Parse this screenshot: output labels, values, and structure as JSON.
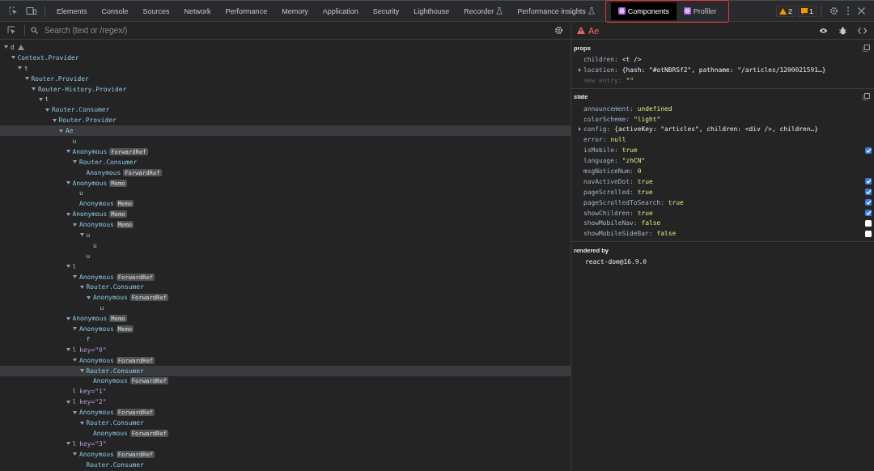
{
  "toolbar": {
    "tabs": [
      {
        "label": "Elements",
        "kind": "plain",
        "selected": false,
        "highlighted": false
      },
      {
        "label": "Console",
        "kind": "plain",
        "selected": false,
        "highlighted": false
      },
      {
        "label": "Sources",
        "kind": "plain",
        "selected": false,
        "highlighted": false
      },
      {
        "label": "Network",
        "kind": "plain",
        "selected": false,
        "highlighted": false
      },
      {
        "label": "Performance",
        "kind": "plain",
        "selected": false,
        "highlighted": false
      },
      {
        "label": "Memory",
        "kind": "plain",
        "selected": false,
        "highlighted": false
      },
      {
        "label": "Application",
        "kind": "plain",
        "selected": false,
        "highlighted": false
      },
      {
        "label": "Security",
        "kind": "plain",
        "selected": false,
        "highlighted": false
      },
      {
        "label": "Lighthouse",
        "kind": "plain",
        "selected": false,
        "highlighted": false
      },
      {
        "label": "Recorder",
        "kind": "experimental",
        "selected": false,
        "highlighted": false
      },
      {
        "label": "Performance insights",
        "kind": "experimental",
        "selected": false,
        "highlighted": false
      },
      {
        "label": "Components",
        "kind": "react",
        "selected": true,
        "highlighted": true
      },
      {
        "label": "Profiler",
        "kind": "react",
        "selected": false,
        "highlighted": true
      }
    ],
    "issues": [
      {
        "kind": "warning",
        "count": "2"
      },
      {
        "kind": "info",
        "count": "1"
      }
    ]
  },
  "tree": {
    "search": {
      "placeholder": "Search (text or /regex/)"
    },
    "nodes": [
      {
        "name": "d",
        "warning": true,
        "selected": false,
        "children": [
          {
            "name": "Context.Provider",
            "selected": false,
            "children": [
              {
                "name": "t",
                "selected": false,
                "children": [
                  {
                    "name": "Router.Provider",
                    "selected": false,
                    "children": [
                      {
                        "name": "Router-History.Provider",
                        "selected": false,
                        "children": [
                          {
                            "name": "t",
                            "selected": false,
                            "children": [
                              {
                                "name": "Router.Consumer",
                                "selected": false,
                                "children": [
                                  {
                                    "name": "Router.Provider",
                                    "selected": false,
                                    "children": [
                                      {
                                        "name": "Ae",
                                        "selected": true,
                                        "children": [
                                          {
                                            "name": "u",
                                            "selected": false
                                          },
                                          {
                                            "name": "Anonymous",
                                            "badge": "ForwardRef",
                                            "selected": false,
                                            "children": [
                                              {
                                                "name": "Router.Consumer",
                                                "selected": false,
                                                "children": [
                                                  {
                                                    "name": "Anonymous",
                                                    "badge": "ForwardRef",
                                                    "selected": false
                                                  }
                                                ]
                                              }
                                            ]
                                          },
                                          {
                                            "name": "Anonymous",
                                            "badge": "Memo",
                                            "selected": false,
                                            "children": [
                                              {
                                                "name": "u",
                                                "selected": false
                                              },
                                              {
                                                "name": "Anonymous",
                                                "badge": "Memo",
                                                "selected": false
                                              }
                                            ]
                                          },
                                          {
                                            "name": "Anonymous",
                                            "badge": "Memo",
                                            "selected": false,
                                            "children": [
                                              {
                                                "name": "Anonymous",
                                                "badge": "Memo",
                                                "selected": false,
                                                "children": [
                                                  {
                                                    "name": "u",
                                                    "selected": false,
                                                    "children": [
                                                      {
                                                        "name": "u",
                                                        "selected": false
                                                      }
                                                    ]
                                                  },
                                                  {
                                                    "name": "u",
                                                    "selected": false
                                                  }
                                                ]
                                              }
                                            ]
                                          },
                                          {
                                            "name": "l",
                                            "selected": false,
                                            "children": [
                                              {
                                                "name": "Anonymous",
                                                "badge": "ForwardRef",
                                                "selected": false,
                                                "children": [
                                                  {
                                                    "name": "Router.Consumer",
                                                    "selected": false,
                                                    "children": [
                                                      {
                                                        "name": "Anonymous",
                                                        "badge": "ForwardRef",
                                                        "selected": false,
                                                        "children": [
                                                          {
                                                            "name": "u",
                                                            "selected": false
                                                          }
                                                        ]
                                                      }
                                                    ]
                                                  }
                                                ]
                                              }
                                            ]
                                          },
                                          {
                                            "name": "Anonymous",
                                            "badge": "Memo",
                                            "selected": false,
                                            "children": [
                                              {
                                                "name": "Anonymous",
                                                "badge": "Memo",
                                                "selected": false,
                                                "children": [
                                                  {
                                                    "name": "f",
                                                    "selected": false
                                                  }
                                                ]
                                              }
                                            ]
                                          },
                                          {
                                            "name": "l",
                                            "key": "key=\"0\"",
                                            "selected": false,
                                            "children": [
                                              {
                                                "name": "Anonymous",
                                                "badge": "ForwardRef",
                                                "selected": false,
                                                "children": [
                                                  {
                                                    "name": "Router.Consumer",
                                                    "selected": true,
                                                    "children": [
                                                      {
                                                        "name": "Anonymous",
                                                        "badge": "ForwardRef",
                                                        "selected": false
                                                      }
                                                    ]
                                                  }
                                                ]
                                              }
                                            ]
                                          },
                                          {
                                            "name": "l",
                                            "key": "key=\"1\"",
                                            "selected": false
                                          },
                                          {
                                            "name": "l",
                                            "key": "key=\"2\"",
                                            "selected": false,
                                            "children": [
                                              {
                                                "name": "Anonymous",
                                                "badge": "ForwardRef",
                                                "selected": false,
                                                "children": [
                                                  {
                                                    "name": "Router.Consumer",
                                                    "selected": false,
                                                    "children": [
                                                      {
                                                        "name": "Anonymous",
                                                        "badge": "ForwardRef",
                                                        "selected": false
                                                      }
                                                    ]
                                                  }
                                                ]
                                              }
                                            ]
                                          },
                                          {
                                            "name": "l",
                                            "key": "key=\"3\"",
                                            "selected": false,
                                            "children": [
                                              {
                                                "name": "Anonymous",
                                                "badge": "ForwardRef",
                                                "selected": false,
                                                "children": [
                                                  {
                                                    "name": "Router.Consumer",
                                                    "selected": false
                                                  }
                                                ]
                                              }
                                            ]
                                          }
                                        ]
                                      }
                                    ]
                                  }
                                ]
                              }
                            ]
                          }
                        ]
                      }
                    ]
                  }
                ]
              }
            ]
          }
        ]
      }
    ]
  },
  "inspector": {
    "component": "Ae",
    "warning": true,
    "sections": [
      {
        "title": "props",
        "items": [
          {
            "kind": "element",
            "name": "children:",
            "value": "<t />"
          },
          {
            "kind": "object",
            "name": "location:",
            "value": "{hash: \"#otNBRSf2\", pathname: \"/articles/1200021591…}"
          },
          {
            "kind": "new-entry",
            "name": "new entry:",
            "value": "\"\""
          }
        ]
      },
      {
        "title": "state",
        "items": [
          {
            "kind": "literal",
            "name": "announcement:",
            "value": "undefined"
          },
          {
            "kind": "literal",
            "name": "colorScheme:",
            "value": "\"light\""
          },
          {
            "kind": "object",
            "name": "config:",
            "value": "{activeKey: \"articles\", children: <div />, children…}"
          },
          {
            "kind": "literal",
            "name": "error:",
            "value": "null"
          },
          {
            "kind": "boolean",
            "name": "isMobile:",
            "value": "true",
            "checked": true
          },
          {
            "kind": "literal",
            "name": "language:",
            "value": "\"zhCN\""
          },
          {
            "kind": "literal",
            "name": "msgNoticeNum:",
            "value": "0"
          },
          {
            "kind": "boolean",
            "name": "navActiveDot:",
            "value": "true",
            "checked": true
          },
          {
            "kind": "boolean",
            "name": "pageScrolled:",
            "value": "true",
            "checked": true
          },
          {
            "kind": "boolean",
            "name": "pageScrolledToSearch:",
            "value": "true",
            "checked": true
          },
          {
            "kind": "boolean",
            "name": "showChildren:",
            "value": "true",
            "checked": true
          },
          {
            "kind": "boolean",
            "name": "showMobileNav:",
            "value": "false",
            "checked": false
          },
          {
            "kind": "boolean",
            "name": "showMobileSideBar:",
            "value": "false",
            "checked": false
          }
        ]
      }
    ],
    "rendered_by": {
      "title": "rendered by",
      "items": [
        "react-dom@16.9.0"
      ]
    }
  }
}
